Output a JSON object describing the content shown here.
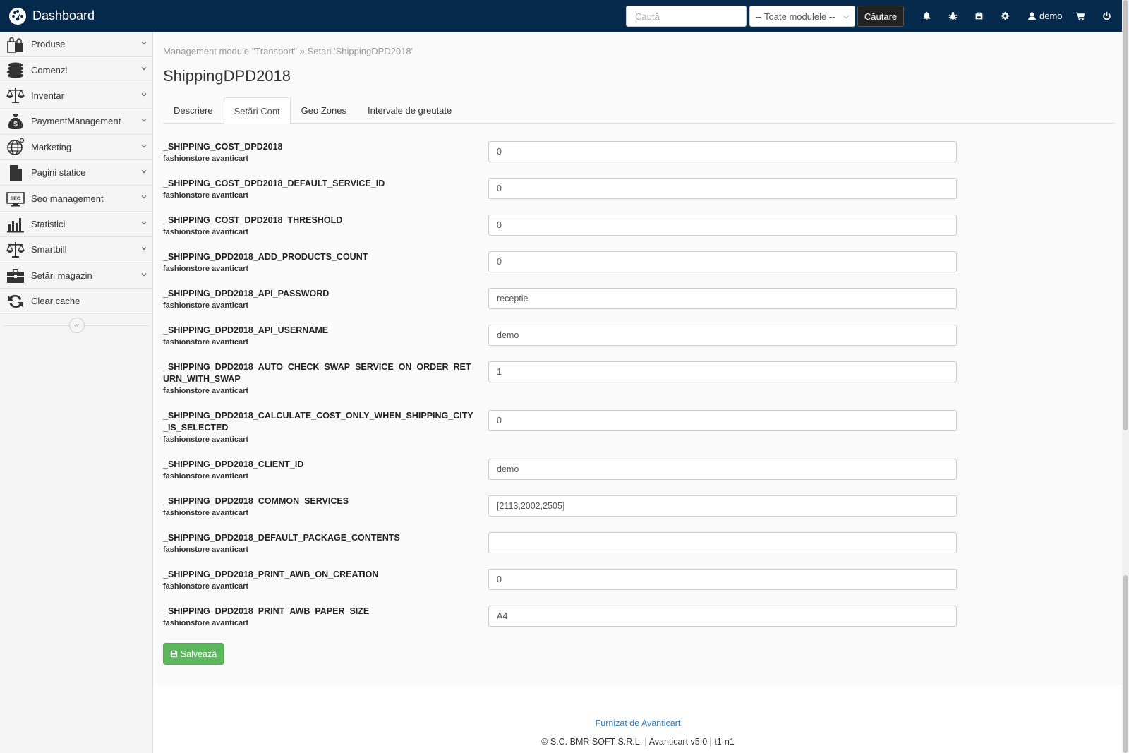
{
  "header": {
    "brand": "Dashboard",
    "search_placeholder": "Caută",
    "module_select": "-- Toate modulele --",
    "search_button": "Căutare",
    "user": "demo"
  },
  "sidebar": {
    "items": [
      {
        "label": "Produse",
        "icon": "shopping-bags-icon"
      },
      {
        "label": "Comenzi",
        "icon": "coins-stack-icon"
      },
      {
        "label": "Inventar",
        "icon": "scale-icon"
      },
      {
        "label": "PaymentManagement",
        "icon": "money-bag-icon"
      },
      {
        "label": "Marketing",
        "icon": "globe-icon"
      },
      {
        "label": "Pagini statice",
        "icon": "document-icon"
      },
      {
        "label": "Seo management",
        "icon": "seo-monitor-icon"
      },
      {
        "label": "Statistici",
        "icon": "bar-chart-icon"
      },
      {
        "label": "Smartbill",
        "icon": "scale-icon"
      },
      {
        "label": "Setări magazin",
        "icon": "toolbox-icon"
      },
      {
        "label": "Clear cache",
        "icon": "refresh-icon"
      }
    ]
  },
  "main": {
    "breadcrumb": "Management module \"Transport\" » Setari 'ShippingDPD2018'",
    "title": "ShippingDPD2018",
    "tabs": [
      "Descriere",
      "Setări Cont",
      "Geo Zones",
      "Intervale de greutate"
    ],
    "active_tab": "Setări Cont",
    "fields": [
      {
        "key": "_SHIPPING_COST_DPD2018",
        "sub": "fashionstore avanticart",
        "value": "0"
      },
      {
        "key": "_SHIPPING_COST_DPD2018_DEFAULT_SERVICE_ID",
        "sub": "fashionstore avanticart",
        "value": "0"
      },
      {
        "key": "_SHIPPING_COST_DPD2018_THRESHOLD",
        "sub": "fashionstore avanticart",
        "value": "0"
      },
      {
        "key": "_SHIPPING_DPD2018_ADD_PRODUCTS_COUNT",
        "sub": "fashionstore avanticart",
        "value": "0"
      },
      {
        "key": "_SHIPPING_DPD2018_API_PASSWORD",
        "sub": "fashionstore avanticart",
        "value": "receptie"
      },
      {
        "key": "_SHIPPING_DPD2018_API_USERNAME",
        "sub": "fashionstore avanticart",
        "value": "demo"
      },
      {
        "key": "_SHIPPING_DPD2018_AUTO_CHECK_SWAP_SERVICE_ON_ORDER_RETURN_WITH_SWAP",
        "sub": "fashionstore avanticart",
        "value": "1"
      },
      {
        "key": "_SHIPPING_DPD2018_CALCULATE_COST_ONLY_WHEN_SHIPPING_CITY_IS_SELECTED",
        "sub": "fashionstore avanticart",
        "value": "0"
      },
      {
        "key": "_SHIPPING_DPD2018_CLIENT_ID",
        "sub": "fashionstore avanticart",
        "value": "demo"
      },
      {
        "key": "_SHIPPING_DPD2018_COMMON_SERVICES",
        "sub": "fashionstore avanticart",
        "value": "[2113,2002,2505]"
      },
      {
        "key": "_SHIPPING_DPD2018_DEFAULT_PACKAGE_CONTENTS",
        "sub": "fashionstore avanticart",
        "value": ""
      },
      {
        "key": "_SHIPPING_DPD2018_PRINT_AWB_ON_CREATION",
        "sub": "fashionstore avanticart",
        "value": "0"
      },
      {
        "key": "_SHIPPING_DPD2018_PRINT_AWB_PAPER_SIZE",
        "sub": "fashionstore avanticart",
        "value": "A4"
      }
    ],
    "save_button": "Salvează"
  },
  "footer": {
    "link": "Furnizat de Avanticart",
    "copyright": "© S.C. BMR SOFT S.R.L. | Avanticart v5.0 | t1-n1"
  }
}
